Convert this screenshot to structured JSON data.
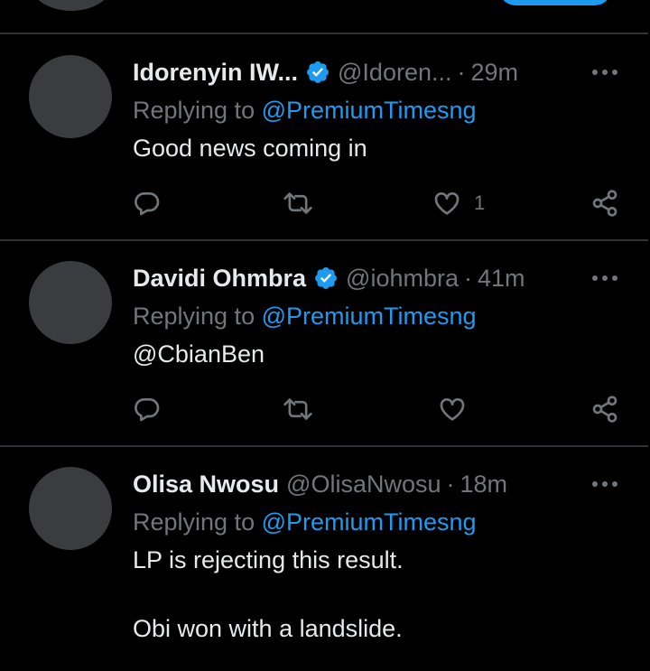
{
  "tweets": [
    {
      "name": "Idorenyin IW...",
      "verified": true,
      "handle": "@Idoren...",
      "time": "29m",
      "replying_prefix": "Replying to ",
      "replying_to": "@PremiumTimesng",
      "text_lines": [
        "Good news coming in"
      ],
      "like_count": "1"
    },
    {
      "name": "Davidi Ohmbra",
      "verified": true,
      "handle": "@iohmbra",
      "time": "41m",
      "replying_prefix": "Replying to ",
      "replying_to": "@PremiumTimesng",
      "mention_line": "@CbianBen",
      "like_count": ""
    },
    {
      "name": "Olisa Nwosu",
      "verified": false,
      "handle": "@OlisaNwosu",
      "time": "18m",
      "replying_prefix": "Replying to ",
      "replying_to": "@PremiumTimesng",
      "text_lines": [
        "LP is rejecting this result.",
        "Obi won with a landslide."
      ]
    }
  ],
  "separator": "·",
  "colors": {
    "background": "#000000",
    "accent": "#1d9bf0",
    "muted": "#71767b",
    "text": "#e7e9ea",
    "divider": "#2f3336"
  },
  "icons": {
    "reply": "reply-icon",
    "retweet": "retweet-icon",
    "like": "like-icon",
    "share": "share-icon",
    "more": "more-icon",
    "verified": "verified-icon"
  }
}
